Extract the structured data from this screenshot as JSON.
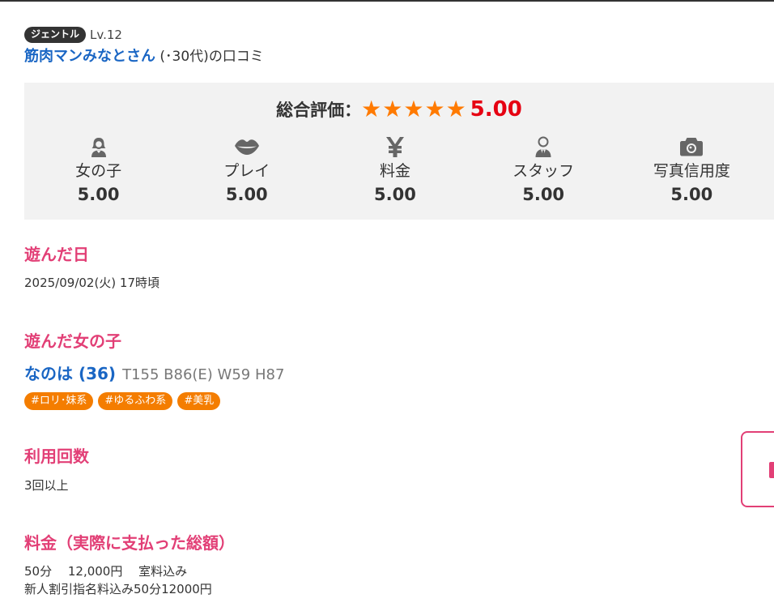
{
  "reviewer": {
    "rank": "ジェントル",
    "level": "Lv.12",
    "name": "筋肉マンみなとさん",
    "age": " (･30代)",
    "suffix": "の口コミ"
  },
  "rating": {
    "overall_label": "総合評価：",
    "stars": "★★★★★",
    "overall_score": "5.00",
    "categories": [
      {
        "icon": "girl-icon",
        "label": "女の子",
        "score": "5.00"
      },
      {
        "icon": "lips-icon",
        "label": "プレイ",
        "score": "5.00"
      },
      {
        "icon": "yen-icon",
        "label": "料金",
        "score": "5.00"
      },
      {
        "icon": "staff-icon",
        "label": "スタッフ",
        "score": "5.00"
      },
      {
        "icon": "camera-icon",
        "label": "写真信用度",
        "score": "5.00"
      }
    ]
  },
  "visit_date": {
    "title": "遊んだ日",
    "value": "2025/09/02(火) 17時頃"
  },
  "girl": {
    "title": "遊んだ女の子",
    "name": "なのは (36)",
    "specs": "T155 B86(E) W59 H87",
    "tags": [
      "#ロリ･妹系",
      "#ゆるふわ系",
      "#美乳"
    ]
  },
  "usage": {
    "title": "利用回数",
    "value": "3回以上"
  },
  "price": {
    "title": "料金（実際に支払った総額）",
    "line1": "50分　 12,000円　 室料込み",
    "line2": "新人割引指名料込み50分12000円"
  },
  "colors": {
    "accent": "#e23f76",
    "link": "#1a66c4",
    "star": "#ff7a00",
    "score": "#e60012",
    "tag": "#f47d00"
  }
}
